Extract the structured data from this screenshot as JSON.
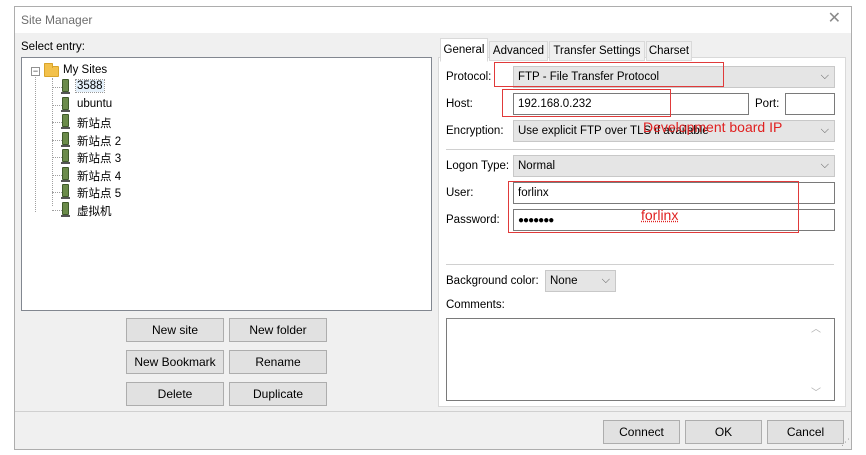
{
  "window": {
    "title": "Site Manager",
    "close_glyph": "✕"
  },
  "tree": {
    "header": "Select entry:",
    "root": {
      "label": "My Sites",
      "expander": "−",
      "icon": "folder-icon"
    },
    "items": [
      {
        "label": "3588",
        "icon": "server-icon",
        "selected": true
      },
      {
        "label": "ubuntu",
        "icon": "server-icon"
      },
      {
        "label": "新站点",
        "icon": "server-icon"
      },
      {
        "label": "新站点 2",
        "icon": "server-icon"
      },
      {
        "label": "新站点 3",
        "icon": "server-icon"
      },
      {
        "label": "新站点 4",
        "icon": "server-icon"
      },
      {
        "label": "新站点 5",
        "icon": "server-icon"
      },
      {
        "label": "虚拟机",
        "icon": "server-icon"
      }
    ]
  },
  "buttons": {
    "new_site": "New site",
    "new_folder": "New folder",
    "new_bookmark": "New Bookmark",
    "rename": "Rename",
    "delete": "Delete",
    "duplicate": "Duplicate"
  },
  "tabs": [
    {
      "label": "General",
      "active": true
    },
    {
      "label": "Advanced"
    },
    {
      "label": "Transfer Settings"
    },
    {
      "label": "Charset"
    }
  ],
  "general": {
    "protocol_label": "Protocol:",
    "protocol_value": "FTP - File Transfer Protocol",
    "host_label": "Host:",
    "host_value": "192.168.0.232",
    "port_label": "Port:",
    "port_value": "",
    "encryption_label": "Encryption:",
    "encryption_value": "Use explicit FTP over TLS if available",
    "logon_type_label": "Logon Type:",
    "logon_type_value": "Normal",
    "user_label": "User:",
    "user_value": "forlinx",
    "password_label": "Password:",
    "password_value": "●●●●●●●",
    "background_color_label": "Background color:",
    "background_color_value": "None",
    "comments_label": "Comments:",
    "comments_value": ""
  },
  "annotations": {
    "host_note": "Development board IP",
    "password_note": "forlinx",
    "color": "#e02020"
  },
  "footer": {
    "connect": "Connect",
    "ok": "OK",
    "cancel": "Cancel"
  }
}
